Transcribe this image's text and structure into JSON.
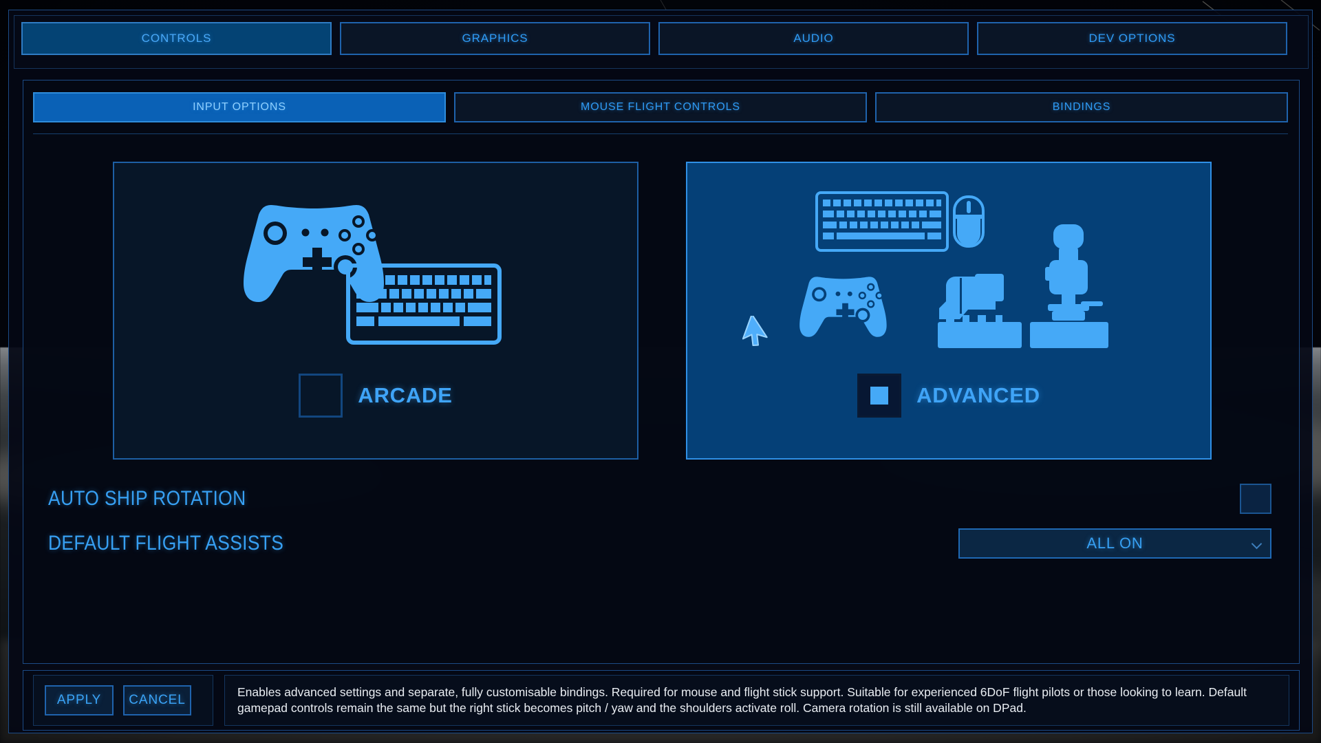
{
  "theme": {
    "bg": "#05070d",
    "panel_bg": "#040914",
    "border": "#1c4b86",
    "accent": "#2f9bf5",
    "accent_bright": "#49a8f8",
    "tab_active_bg": "#044374",
    "subtab_active_bg": "#0a61b6",
    "card_arcade_bg": "#071628",
    "card_advanced_bg": "#054077",
    "icon_blue": "#45a9f7",
    "text_white": "#e9edf2"
  },
  "top_tabs": [
    {
      "label": "CONTROLS",
      "active": true
    },
    {
      "label": "GRAPHICS",
      "active": false
    },
    {
      "label": "AUDIO",
      "active": false
    },
    {
      "label": "DEV OPTIONS",
      "active": false
    }
  ],
  "sub_tabs": [
    {
      "label": "INPUT OPTIONS",
      "active": true
    },
    {
      "label": "MOUSE FLIGHT CONTROLS",
      "active": false
    },
    {
      "label": "BINDINGS",
      "active": false
    }
  ],
  "mode_cards": [
    {
      "label": "ARCADE",
      "selected": false,
      "icons": [
        "gamepad-icon",
        "keyboard-icon"
      ]
    },
    {
      "label": "ADVANCED",
      "selected": true,
      "icons": [
        "keyboard-icon",
        "mouse-icon",
        "gamepad-icon",
        "throttle-icon",
        "joystick-icon",
        "cursor-arrow-icon"
      ]
    }
  ],
  "settings": [
    {
      "label": "AUTO SHIP ROTATION",
      "control": "checkbox",
      "checked": false,
      "value": ""
    },
    {
      "label": "DEFAULT FLIGHT ASSISTS",
      "control": "dropdown",
      "checked": false,
      "value": "ALL ON"
    }
  ],
  "footer": {
    "apply_label": "APPLY",
    "cancel_label": "CANCEL",
    "description": "Enables advanced settings and separate, fully customisable bindings. Required for mouse and flight stick support. Suitable for experienced 6DoF flight pilots or those looking to learn. Default gamepad controls remain the same but the right stick becomes pitch / yaw and the shoulders activate roll. Camera rotation is still available on DPad."
  }
}
